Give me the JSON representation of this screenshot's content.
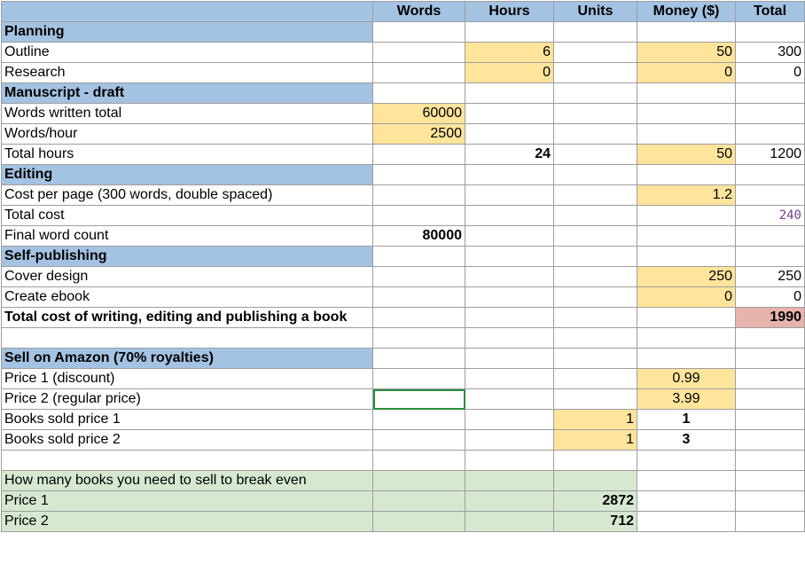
{
  "headers": [
    "Words",
    "Hours",
    "Units",
    "Money ($)",
    "Total"
  ],
  "sections": {
    "planning": "Planning",
    "manuscript": "Manuscript - draft",
    "editing": "Editing",
    "selfpub": "Self-publishing",
    "amazon": "Sell on Amazon (70% royalties)"
  },
  "rows": {
    "outline": {
      "label": "Outline",
      "hours": "6",
      "money": "50",
      "total": "300"
    },
    "research": {
      "label": "Research",
      "hours": "0",
      "money": "0",
      "total": "0"
    },
    "words_total": {
      "label": "Words written total",
      "words": "60000"
    },
    "words_hour": {
      "label": "Words/hour",
      "words": "2500"
    },
    "total_hours": {
      "label": "Total hours",
      "hours": "24",
      "money": "50",
      "total": "1200"
    },
    "cost_page": {
      "label": "Cost per page (300 words, double spaced)",
      "money": "1.2"
    },
    "total_cost": {
      "label": "Total cost",
      "total": "240"
    },
    "final_words": {
      "label": "Final word count",
      "words": "80000"
    },
    "cover": {
      "label": "Cover design",
      "money": "250",
      "total": "250"
    },
    "ebook": {
      "label": "Create ebook",
      "money": "0",
      "total": "0"
    },
    "grand_total": {
      "label": "Total cost of writing, editing and publishing a book",
      "total": "1990"
    },
    "price1": {
      "label": "Price 1 (discount)",
      "money": "0.99"
    },
    "price2": {
      "label": "Price 2 (regular price)",
      "money": "3.99"
    },
    "sold1": {
      "label": "Books sold price 1",
      "units": "1",
      "money": "1"
    },
    "sold2": {
      "label": "Books sold price 2",
      "units": "1",
      "money": "3"
    },
    "breakeven": {
      "label": "How many books you need to sell to break even"
    },
    "be_price1": {
      "label": "Price 1",
      "units": "2872"
    },
    "be_price2": {
      "label": "Price 2",
      "units": "712"
    }
  }
}
